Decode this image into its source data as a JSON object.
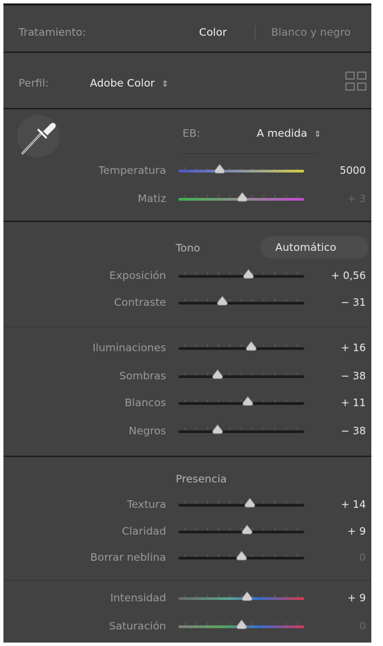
{
  "treatment": {
    "label": "Tratamiento:",
    "options": [
      "Color",
      "Blanco y negro"
    ],
    "active": "Color"
  },
  "profile": {
    "label": "Perfil:",
    "value": "Adobe Color",
    "browse_icon": "grid-icon"
  },
  "white_balance": {
    "picker_icon": "eyedropper-icon",
    "label": "EB:",
    "value": "A medida",
    "sliders": [
      {
        "label": "Temperatura",
        "value_text": "5000",
        "position": 0.33,
        "track": "temp",
        "dim": false
      },
      {
        "label": "Matiz",
        "value_text": "+ 3",
        "position": 0.51,
        "track": "tint",
        "dim": true
      }
    ]
  },
  "tone": {
    "title": "Tono",
    "auto_button": "Automático",
    "sliders": [
      {
        "label": "Exposición",
        "value_text": "+ 0,56",
        "position": 0.56,
        "dim": false
      },
      {
        "label": "Contraste",
        "value_text": "− 31",
        "position": 0.35,
        "dim": false
      }
    ],
    "sliders2": [
      {
        "label": "Iluminaciones",
        "value_text": "+ 16",
        "position": 0.58,
        "dim": false
      },
      {
        "label": "Sombras",
        "value_text": "− 38",
        "position": 0.31,
        "dim": false
      },
      {
        "label": "Blancos",
        "value_text": "+ 11",
        "position": 0.55,
        "dim": false
      },
      {
        "label": "Negros",
        "value_text": "− 38",
        "position": 0.31,
        "dim": false
      }
    ]
  },
  "presence": {
    "title": "Presencia",
    "sliders": [
      {
        "label": "Textura",
        "value_text": "+ 14",
        "position": 0.57,
        "dim": false
      },
      {
        "label": "Claridad",
        "value_text": "+ 9",
        "position": 0.545,
        "dim": false
      },
      {
        "label": "Borrar neblina",
        "value_text": "0",
        "position": 0.5,
        "dim": true
      }
    ],
    "sliders2": [
      {
        "label": "Intensidad",
        "value_text": "+ 9",
        "position": 0.545,
        "track": "vib",
        "dim": false
      },
      {
        "label": "Saturación",
        "value_text": "0",
        "position": 0.5,
        "track": "sat",
        "dim": true
      }
    ]
  },
  "colors": {
    "panel_bg": "#424242",
    "divider": "#1c1c1c",
    "label_text": "#9a9a9a",
    "value_text": "#eaeaea"
  }
}
